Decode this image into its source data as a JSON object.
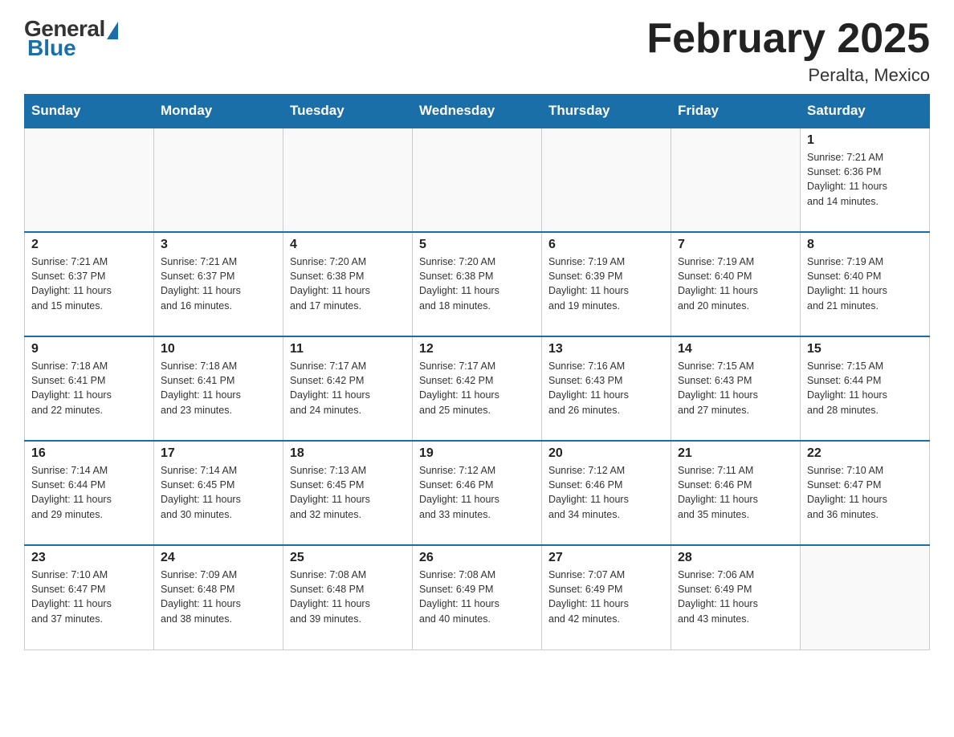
{
  "header": {
    "logo": {
      "general": "General",
      "blue": "Blue"
    },
    "title": "February 2025",
    "location": "Peralta, Mexico"
  },
  "weekdays": [
    "Sunday",
    "Monday",
    "Tuesday",
    "Wednesday",
    "Thursday",
    "Friday",
    "Saturday"
  ],
  "weeks": [
    [
      {
        "day": "",
        "info": ""
      },
      {
        "day": "",
        "info": ""
      },
      {
        "day": "",
        "info": ""
      },
      {
        "day": "",
        "info": ""
      },
      {
        "day": "",
        "info": ""
      },
      {
        "day": "",
        "info": ""
      },
      {
        "day": "1",
        "info": "Sunrise: 7:21 AM\nSunset: 6:36 PM\nDaylight: 11 hours\nand 14 minutes."
      }
    ],
    [
      {
        "day": "2",
        "info": "Sunrise: 7:21 AM\nSunset: 6:37 PM\nDaylight: 11 hours\nand 15 minutes."
      },
      {
        "day": "3",
        "info": "Sunrise: 7:21 AM\nSunset: 6:37 PM\nDaylight: 11 hours\nand 16 minutes."
      },
      {
        "day": "4",
        "info": "Sunrise: 7:20 AM\nSunset: 6:38 PM\nDaylight: 11 hours\nand 17 minutes."
      },
      {
        "day": "5",
        "info": "Sunrise: 7:20 AM\nSunset: 6:38 PM\nDaylight: 11 hours\nand 18 minutes."
      },
      {
        "day": "6",
        "info": "Sunrise: 7:19 AM\nSunset: 6:39 PM\nDaylight: 11 hours\nand 19 minutes."
      },
      {
        "day": "7",
        "info": "Sunrise: 7:19 AM\nSunset: 6:40 PM\nDaylight: 11 hours\nand 20 minutes."
      },
      {
        "day": "8",
        "info": "Sunrise: 7:19 AM\nSunset: 6:40 PM\nDaylight: 11 hours\nand 21 minutes."
      }
    ],
    [
      {
        "day": "9",
        "info": "Sunrise: 7:18 AM\nSunset: 6:41 PM\nDaylight: 11 hours\nand 22 minutes."
      },
      {
        "day": "10",
        "info": "Sunrise: 7:18 AM\nSunset: 6:41 PM\nDaylight: 11 hours\nand 23 minutes."
      },
      {
        "day": "11",
        "info": "Sunrise: 7:17 AM\nSunset: 6:42 PM\nDaylight: 11 hours\nand 24 minutes."
      },
      {
        "day": "12",
        "info": "Sunrise: 7:17 AM\nSunset: 6:42 PM\nDaylight: 11 hours\nand 25 minutes."
      },
      {
        "day": "13",
        "info": "Sunrise: 7:16 AM\nSunset: 6:43 PM\nDaylight: 11 hours\nand 26 minutes."
      },
      {
        "day": "14",
        "info": "Sunrise: 7:15 AM\nSunset: 6:43 PM\nDaylight: 11 hours\nand 27 minutes."
      },
      {
        "day": "15",
        "info": "Sunrise: 7:15 AM\nSunset: 6:44 PM\nDaylight: 11 hours\nand 28 minutes."
      }
    ],
    [
      {
        "day": "16",
        "info": "Sunrise: 7:14 AM\nSunset: 6:44 PM\nDaylight: 11 hours\nand 29 minutes."
      },
      {
        "day": "17",
        "info": "Sunrise: 7:14 AM\nSunset: 6:45 PM\nDaylight: 11 hours\nand 30 minutes."
      },
      {
        "day": "18",
        "info": "Sunrise: 7:13 AM\nSunset: 6:45 PM\nDaylight: 11 hours\nand 32 minutes."
      },
      {
        "day": "19",
        "info": "Sunrise: 7:12 AM\nSunset: 6:46 PM\nDaylight: 11 hours\nand 33 minutes."
      },
      {
        "day": "20",
        "info": "Sunrise: 7:12 AM\nSunset: 6:46 PM\nDaylight: 11 hours\nand 34 minutes."
      },
      {
        "day": "21",
        "info": "Sunrise: 7:11 AM\nSunset: 6:46 PM\nDaylight: 11 hours\nand 35 minutes."
      },
      {
        "day": "22",
        "info": "Sunrise: 7:10 AM\nSunset: 6:47 PM\nDaylight: 11 hours\nand 36 minutes."
      }
    ],
    [
      {
        "day": "23",
        "info": "Sunrise: 7:10 AM\nSunset: 6:47 PM\nDaylight: 11 hours\nand 37 minutes."
      },
      {
        "day": "24",
        "info": "Sunrise: 7:09 AM\nSunset: 6:48 PM\nDaylight: 11 hours\nand 38 minutes."
      },
      {
        "day": "25",
        "info": "Sunrise: 7:08 AM\nSunset: 6:48 PM\nDaylight: 11 hours\nand 39 minutes."
      },
      {
        "day": "26",
        "info": "Sunrise: 7:08 AM\nSunset: 6:49 PM\nDaylight: 11 hours\nand 40 minutes."
      },
      {
        "day": "27",
        "info": "Sunrise: 7:07 AM\nSunset: 6:49 PM\nDaylight: 11 hours\nand 42 minutes."
      },
      {
        "day": "28",
        "info": "Sunrise: 7:06 AM\nSunset: 6:49 PM\nDaylight: 11 hours\nand 43 minutes."
      },
      {
        "day": "",
        "info": ""
      }
    ]
  ]
}
